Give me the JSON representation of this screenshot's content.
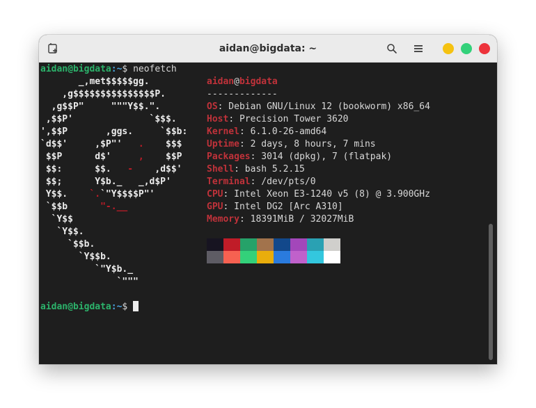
{
  "window": {
    "title": "aidan@bigdata: ~",
    "buttons": {
      "minimize_color": "#f5c211",
      "maximize_color": "#33d17a",
      "close_color": "#ed333b"
    }
  },
  "terminal": {
    "prompt_user": "aidan@bigdata",
    "prompt_path": ":~",
    "prompt_symbol": "$ ",
    "command": "neofetch",
    "logo": [
      [
        {
          "t": "       _,met$$$$$gg.",
          "c": "w"
        }
      ],
      [
        {
          "t": "    ,g$$$$$$$$$$$$$$$P.",
          "c": "w"
        }
      ],
      [
        {
          "t": "  ,g$$P\"     \"\"\"Y$$.\".",
          "c": "w"
        }
      ],
      [
        {
          "t": " ,$$P'              `$$$.",
          "c": "w"
        }
      ],
      [
        {
          "t": "',$$P       ,ggs.     `$$b:",
          "c": "w"
        }
      ],
      [
        {
          "t": "`d$$'     ,$P\"'   ",
          "c": "w"
        },
        {
          "t": ".",
          "c": "r"
        },
        {
          "t": "    $$$",
          "c": "w"
        }
      ],
      [
        {
          "t": " $$P      d$'     ",
          "c": "w"
        },
        {
          "t": ",",
          "c": "r"
        },
        {
          "t": "    $$P",
          "c": "w"
        }
      ],
      [
        {
          "t": " $$:      $$.   ",
          "c": "w"
        },
        {
          "t": "-",
          "c": "r"
        },
        {
          "t": "    ,d$$'",
          "c": "w"
        }
      ],
      [
        {
          "t": " $$;      Y$b._   _,d$P'",
          "c": "w"
        }
      ],
      [
        {
          "t": " Y$$.    ",
          "c": "w"
        },
        {
          "t": "`.",
          "c": "r"
        },
        {
          "t": "`\"Y$$$$P\"'",
          "c": "w"
        }
      ],
      [
        {
          "t": " `$$b      ",
          "c": "w"
        },
        {
          "t": "\"-.__",
          "c": "r"
        }
      ],
      [
        {
          "t": "  `Y$$",
          "c": "w"
        }
      ],
      [
        {
          "t": "   `Y$$.",
          "c": "w"
        }
      ],
      [
        {
          "t": "     `$$b.",
          "c": "w"
        }
      ],
      [
        {
          "t": "       `Y$$b.",
          "c": "w"
        }
      ],
      [
        {
          "t": "          `\"Y$b._",
          "c": "w"
        }
      ],
      [
        {
          "t": "              `\"\"\"",
          "c": "w"
        }
      ]
    ],
    "info": {
      "user": "aidan",
      "at": "@",
      "host": "bigdata",
      "separator": "-------------",
      "rows": [
        {
          "key": "OS",
          "value": ": Debian GNU/Linux 12 (bookworm) x86_64"
        },
        {
          "key": "Host",
          "value": ": Precision Tower 3620"
        },
        {
          "key": "Kernel",
          "value": ": 6.1.0-26-amd64"
        },
        {
          "key": "Uptime",
          "value": ": 2 days, 8 hours, 7 mins"
        },
        {
          "key": "Packages",
          "value": ": 3014 (dpkg), 7 (flatpak)"
        },
        {
          "key": "Shell",
          "value": ": bash 5.2.15"
        },
        {
          "key": "Terminal",
          "value": ": /dev/pts/0"
        },
        {
          "key": "CPU",
          "value": ": Intel Xeon E3-1240 v5 (8) @ 3.900GHz"
        },
        {
          "key": "GPU",
          "value": ": Intel DG2 [Arc A310]"
        },
        {
          "key": "Memory",
          "value": ": 18391MiB / 32027MiB"
        }
      ],
      "palette_dark": [
        "#171421",
        "#c01c28",
        "#26a269",
        "#a2734c",
        "#12488b",
        "#a347ba",
        "#2aa1b3",
        "#d0cfcc"
      ],
      "palette_bright": [
        "#5e5c64",
        "#f66151",
        "#33d17a",
        "#e9ad0c",
        "#2a7bde",
        "#c061cb",
        "#33c7de",
        "#ffffff"
      ]
    }
  }
}
